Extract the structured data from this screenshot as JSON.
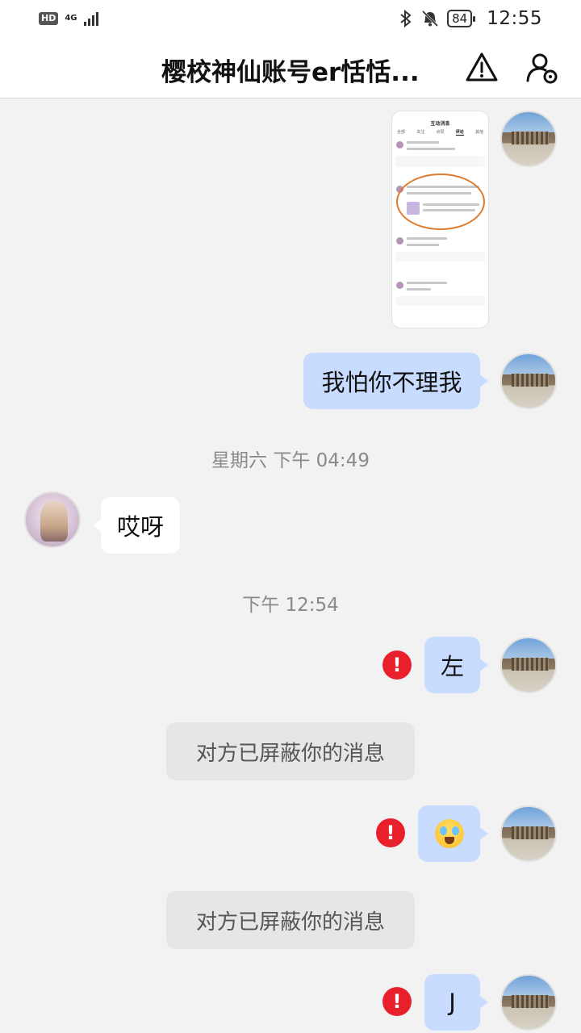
{
  "status_bar": {
    "hd": "HD",
    "network": "4G",
    "battery": "84",
    "time": "12:55"
  },
  "header": {
    "title": "樱校神仙账号er恬恬..."
  },
  "messages": {
    "msg1_text": "我怕你不理我",
    "ts1": "星期六 下午 04:49",
    "msg2_text": "哎呀",
    "ts2": "下午 12:54",
    "msg3_text": "左",
    "notice1": "对方已屏蔽你的消息",
    "notice2": "对方已屏蔽你的消息",
    "msg5_text": "J"
  },
  "thumbnail": {
    "title": "互动消息",
    "tabs": [
      "全部",
      "关注",
      "点赞",
      "评论",
      "其他"
    ]
  },
  "colors": {
    "my_bubble": "#c8dcff",
    "other_bubble": "#ffffff",
    "error_red": "#e8202b",
    "background": "#f2f2f2"
  },
  "icons": {
    "report": "warning-triangle-icon",
    "profile": "user-settings-icon",
    "failed": "exclamation-circle-icon",
    "status": [
      "bluetooth-icon",
      "mute-bell-icon",
      "signal-icon",
      "battery-icon"
    ]
  }
}
